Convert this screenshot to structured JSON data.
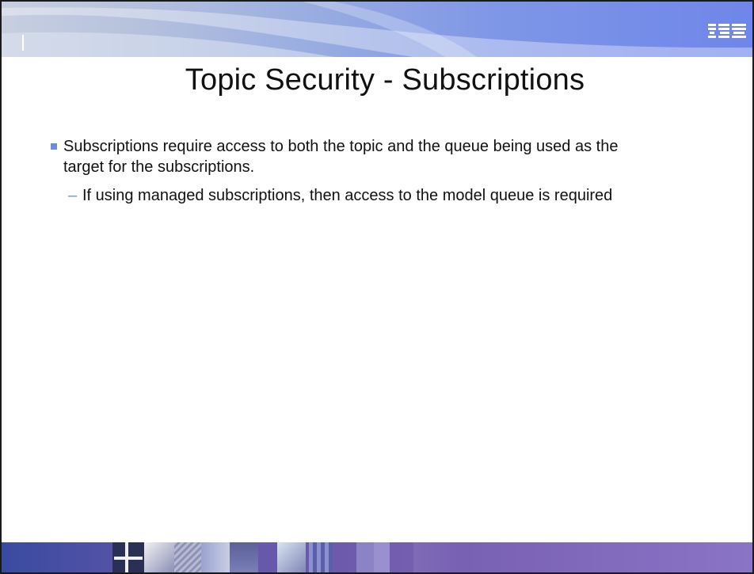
{
  "header": {
    "logo_text": "IBM",
    "colors": {
      "banner_start": "#c7cfe0",
      "banner_end": "#6f86ea",
      "footer_start": "#3a4aa0",
      "footer_end": "#8a74c6",
      "bullet_accent": "#6b8fe0"
    }
  },
  "slide": {
    "title": "Topic Security - Subscriptions",
    "bullets": [
      {
        "text": "Subscriptions require access to both the topic and the queue being used as the target for the subscriptions.",
        "sub_bullets": [
          {
            "marker": "–",
            "text": "If using managed subscriptions, then access to the model queue is required"
          }
        ]
      }
    ]
  }
}
